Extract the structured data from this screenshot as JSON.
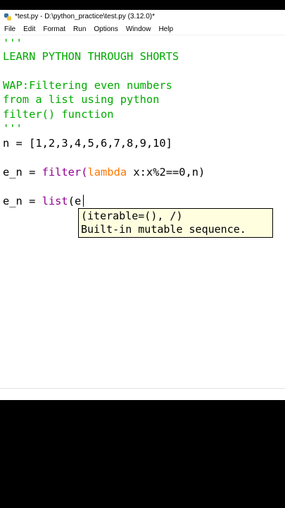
{
  "window": {
    "title": "*test.py - D:\\python_practice\\test.py (3.12.0)*",
    "icon": "python-idle-icon"
  },
  "menu": {
    "items": [
      "File",
      "Edit",
      "Format",
      "Run",
      "Options",
      "Window",
      "Help"
    ]
  },
  "editor": {
    "lines": {
      "l1": "'''",
      "l2": "LEARN PYTHON THROUGH SHORTS",
      "l4": "WAP:Filtering even numbers",
      "l5": "from a list using python",
      "l6": "filter() function",
      "l7": "'''",
      "l8": "n = [1,2,3,4,5,6,7,8,9,10]",
      "l10_a": "e_n = ",
      "l10_b": "filter",
      "l10_c": "(",
      "l10_d": "lambda",
      "l10_e": " x:x%2==0,n)",
      "l12_a": "e_n = ",
      "l12_b": "list",
      "l12_c": "(e"
    },
    "colors": {
      "string": "#00aa00",
      "builtin": "#900090",
      "keyword": "#ff7700"
    }
  },
  "calltip": {
    "signature": "(iterable=(), /)",
    "doc": "Built-in mutable sequence."
  }
}
